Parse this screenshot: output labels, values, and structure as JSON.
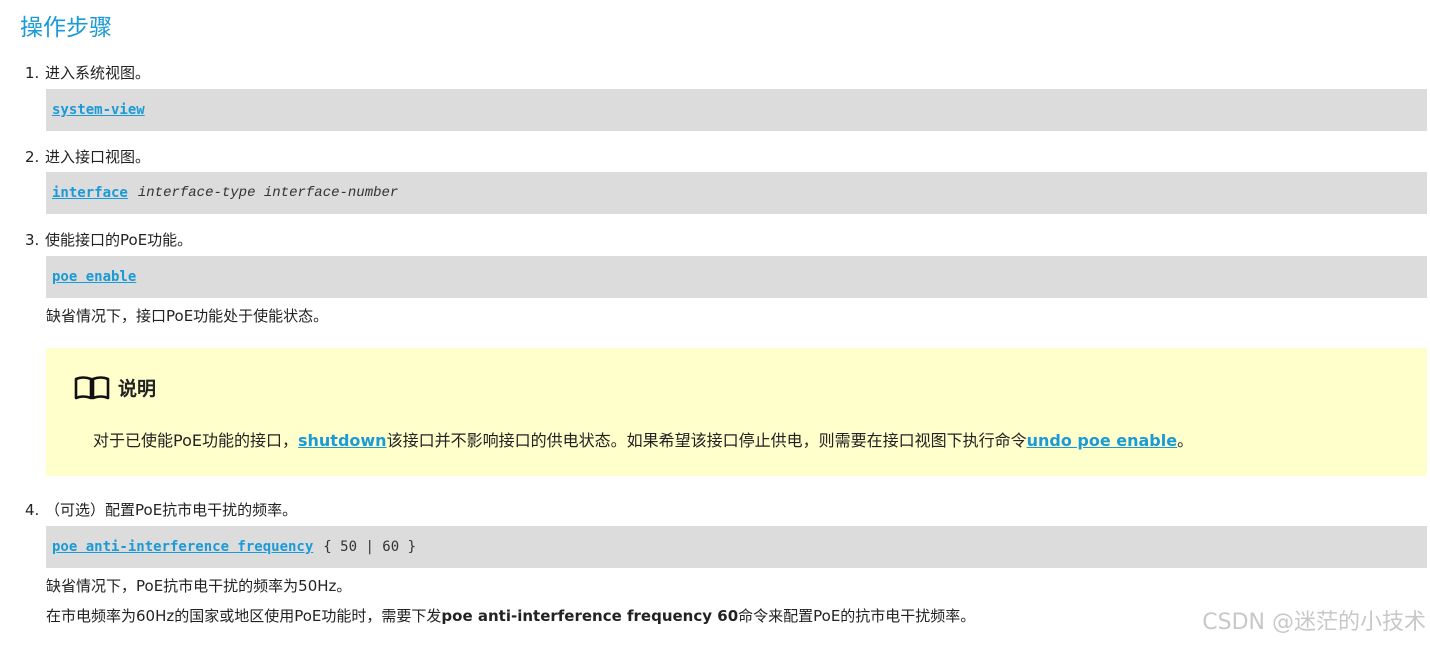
{
  "title": "操作步骤",
  "steps": [
    {
      "num": "1.",
      "text": "进入系统视图。",
      "code": {
        "command": "system-view",
        "params": ""
      }
    },
    {
      "num": "2.",
      "text": "进入接口视图。",
      "code": {
        "command": "interface",
        "params": "interface-type interface-number"
      }
    },
    {
      "num": "3.",
      "text": "使能接口的PoE功能。",
      "code": {
        "command": "poe enable",
        "params": ""
      },
      "default_text": "缺省情况下，接口PoE功能处于使能状态。"
    },
    {
      "num": "4.",
      "text": "（可选）配置PoE抗市电干扰的频率。",
      "code": {
        "command": "poe anti-interference frequency",
        "args": "{ 50 | 60 }"
      },
      "default_text": "缺省情况下，PoE抗市电干扰的频率为50Hz。",
      "extra": {
        "before": "在市电频率为60Hz的国家或地区使用PoE功能时，需要下发",
        "bold": "poe anti-interference frequency 60",
        "after": "命令来配置PoE的抗市电干扰频率。"
      }
    }
  ],
  "note": {
    "heading": "说明",
    "icon": "book-icon",
    "text_before": "对于已使能PoE功能的接口，",
    "link1": "shutdown",
    "text_middle": "该接口并不影响接口的供电状态。如果希望该接口停止供电，则需要在接口视图下执行命令",
    "link2": "undo poe enable",
    "text_after": "。"
  },
  "watermark": "CSDN @迷茫的小技术",
  "colors": {
    "accent": "#1a9ad6",
    "code_bg": "#dcdcdc",
    "note_bg": "#ffffcc"
  }
}
